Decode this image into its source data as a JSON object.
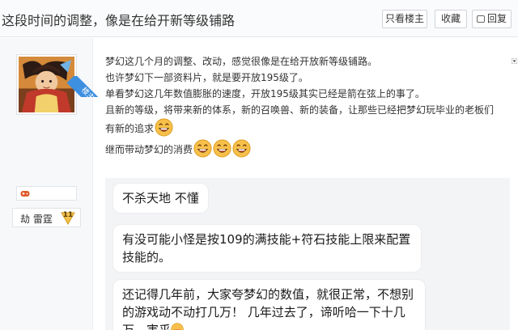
{
  "header": {
    "title": "这段时间的调整，像是在给开新等级铺路",
    "only_lz_label": "只看楼主",
    "favorite_label": "收藏",
    "reply_label": "回复"
  },
  "author": {
    "badge_name": "劫 雷霆",
    "badge_level": "11",
    "ribbon_label": "楼主"
  },
  "post": {
    "lines": [
      "梦幻这几个月的调整、改动，感觉很像是在给开放新等级铺路。",
      "也许梦幻下一部资料片，就是要开放195级了。",
      "单看梦幻这几年数值膨胀的速度，开放195级其实已经是箭在弦上的事了。",
      "且新的等级，将带来新的体系，新的召唤兽、新的装备，让那些已经把梦幻玩毕业的老板们",
      "有新的追求",
      "继而带动梦幻的消费"
    ]
  },
  "comments": [
    {
      "text": "不杀天地 不懂"
    },
    {
      "text": "有没可能小怪是按109的满技能+符石技能上限来配置技能的。"
    },
    {
      "text": "还记得几年前，大家夸梦幻的数值，就很正常，不想别的游戏动不动打几万！ 几年过去了，谛听哈一下十几万，害乎"
    }
  ],
  "icons": {
    "emoticon": "laughing-face-icon",
    "reply": "reply-bubble-icon",
    "game": "game-controller-icon"
  },
  "colors": {
    "ribbon": "#3d8fe0",
    "emoticon": "#f7c04a",
    "badge": "#f2c14e"
  }
}
